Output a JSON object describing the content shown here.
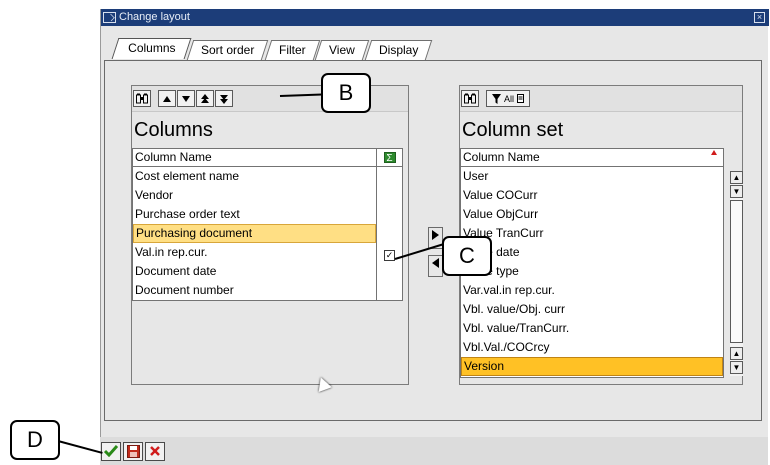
{
  "window": {
    "title": "Change layout"
  },
  "tabs": [
    "Columns",
    "Sort order",
    "Filter",
    "View",
    "Display"
  ],
  "left_box": {
    "title": "Columns",
    "column_header": "Column Name",
    "rows": [
      "Cost element name",
      "Vendor",
      "Purchase order text",
      "Purchasing document",
      "Val.in rep.cur.",
      "Document date",
      "Document number"
    ],
    "selected_row_index": 3,
    "checked_row_index": 4
  },
  "right_box": {
    "title": "Column set",
    "column_header": "Column Name",
    "toolbar_filter_label": "All",
    "rows": [
      "User",
      "Value COCurr",
      "Value ObjCurr",
      "Value TranCurr",
      "Value date",
      "Value type",
      "Var.val.in rep.cur.",
      "Vbl. value/Obj. curr",
      "Vbl. value/TranCurr.",
      "Vbl.Val./COCrcy",
      "Version"
    ],
    "selected_row_index": 10
  },
  "callouts": {
    "b": "B",
    "c": "C",
    "d": "D"
  },
  "icons": {
    "find": "binoculars-icon",
    "up": "arrow-up-icon",
    "down": "arrow-down-icon",
    "top": "arrow-top-icon",
    "bottom": "arrow-bottom-icon",
    "sum": "sigma-icon",
    "ok": "checkmark-icon",
    "save": "save-icon",
    "cancel": "cancel-icon"
  },
  "colors": {
    "titlebar": "#1c3d79",
    "selected_row": "#ffdf84",
    "selected_row_strong": "#ffc125",
    "ok_icon": "#2a8a18",
    "cancel_icon": "#d01b1b"
  }
}
